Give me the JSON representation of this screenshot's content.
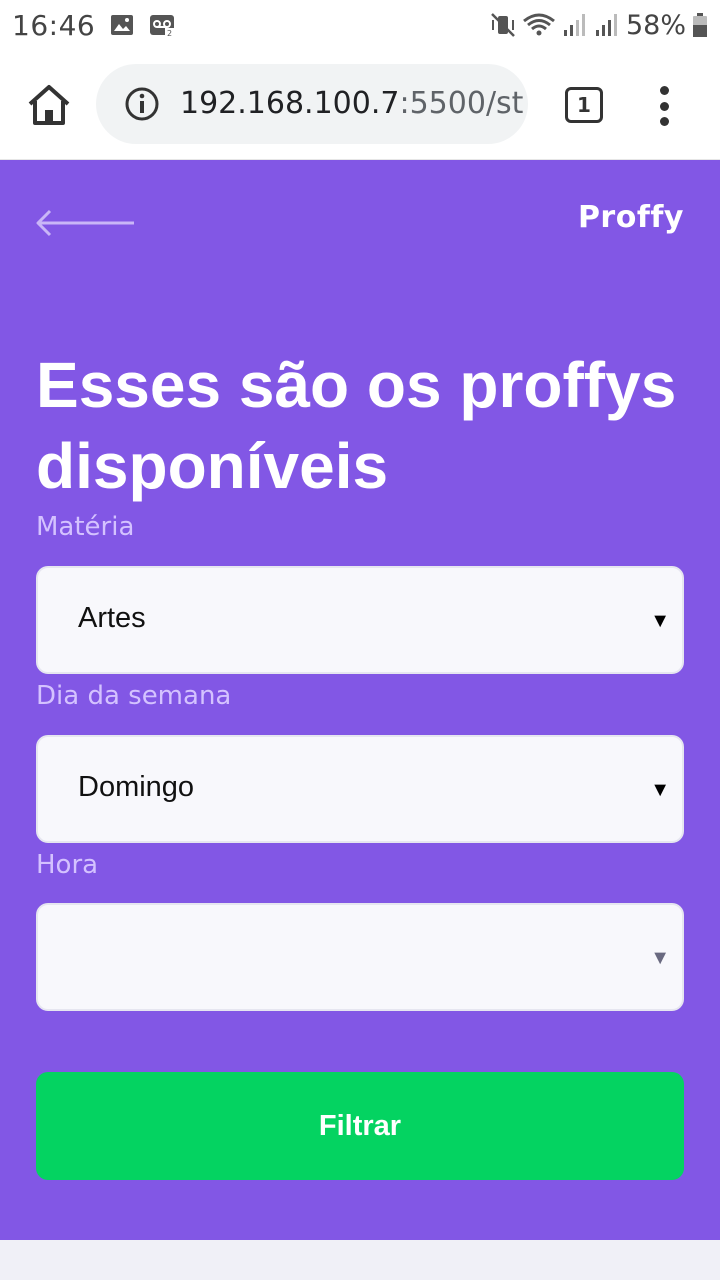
{
  "status_bar": {
    "time": "16:46",
    "battery": "58%",
    "icons": [
      "image-icon",
      "voicemail-icon",
      "mute-vibrate-icon",
      "wifi-icon",
      "signal-icon",
      "signal-icon",
      "battery-icon"
    ]
  },
  "browser": {
    "url_host": "192.168.100.7",
    "url_path": ":5500/st",
    "tab_count": "1"
  },
  "header": {
    "logo": "Proffy",
    "title": "Esses são os proffys disponíveis"
  },
  "form": {
    "subject": {
      "label": "Matéria",
      "value": "Artes"
    },
    "weekday": {
      "label": "Dia da semana",
      "value": "Domingo"
    },
    "time": {
      "label": "Hora",
      "value": ""
    },
    "submit_label": "Filtrar"
  },
  "colors": {
    "primary": "#8257E5",
    "accent": "#04D361",
    "label": "#D4C2FF",
    "input_bg": "#F8F8FC"
  }
}
